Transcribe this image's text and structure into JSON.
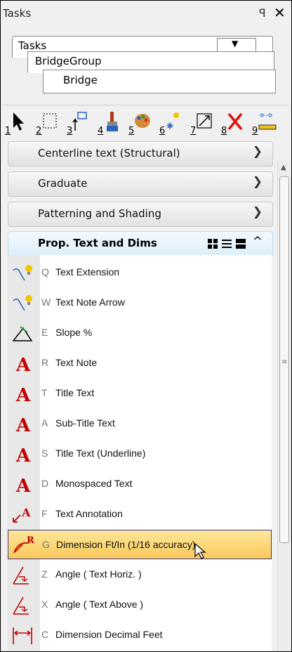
{
  "window": {
    "title": "Tasks",
    "pin_glyph": "⊥",
    "close_glyph": "✕"
  },
  "tabs": {
    "level1": {
      "label": "Tasks",
      "dropdown_glyph": "▼"
    },
    "level2": {
      "label": "BridgeGroup"
    },
    "level3": {
      "label": "Bridge"
    }
  },
  "toolbar": {
    "items": [
      {
        "num": "1",
        "icon": "select-arrow-icon"
      },
      {
        "num": "2",
        "icon": "fence-select-icon"
      },
      {
        "num": "3",
        "icon": "move-copy-icon"
      },
      {
        "num": "4",
        "icon": "paint-brush-icon"
      },
      {
        "num": "5",
        "icon": "palette-icon"
      },
      {
        "num": "6",
        "icon": "sparkle-icon"
      },
      {
        "num": "7",
        "icon": "scale-icon"
      },
      {
        "num": "8",
        "icon": "delete-icon"
      },
      {
        "num": "9",
        "icon": "measure-icon"
      }
    ]
  },
  "sections": [
    {
      "label": "Centerline text (Structural)"
    },
    {
      "label": "Graduate"
    },
    {
      "label": "Patterning and Shading"
    }
  ],
  "open_section": {
    "label": "Prop. Text and Dims"
  },
  "list": [
    {
      "key": "Q",
      "label": "Text Extension",
      "icon": "text-extension-icon"
    },
    {
      "key": "W",
      "label": "Text Note Arrow",
      "icon": "text-note-arrow-icon"
    },
    {
      "key": "E",
      "label": "Slope %",
      "icon": "slope-icon"
    },
    {
      "key": "R",
      "label": "Text Note",
      "icon": "text-a-icon"
    },
    {
      "key": "T",
      "label": "Title Text",
      "icon": "text-a-icon"
    },
    {
      "key": "A",
      "label": "Sub-Title Text",
      "icon": "text-a-icon"
    },
    {
      "key": "S",
      "label": "Title Text (Underline)",
      "icon": "text-a-icon"
    },
    {
      "key": "D",
      "label": "Monospaced Text",
      "icon": "text-a-icon"
    },
    {
      "key": "F",
      "label": "Text Annotation",
      "icon": "text-annotation-icon"
    },
    {
      "key": "G",
      "label": "Dimension Ft/In (1/16 accuracy)",
      "icon": "dimension-icon",
      "selected": true
    },
    {
      "key": "Z",
      "label": "Angle ( Text Horiz. )",
      "icon": "angle-icon"
    },
    {
      "key": "X",
      "label": "Angle ( Text Above )",
      "icon": "angle-icon"
    },
    {
      "key": "C",
      "label": "Dimension Decimal Feet",
      "icon": "dimension-decimal-icon"
    }
  ],
  "colors": {
    "selected_bg": "#f9c85a",
    "accent_red": "#cc0000",
    "section_open_bg": "#dbeefa"
  }
}
